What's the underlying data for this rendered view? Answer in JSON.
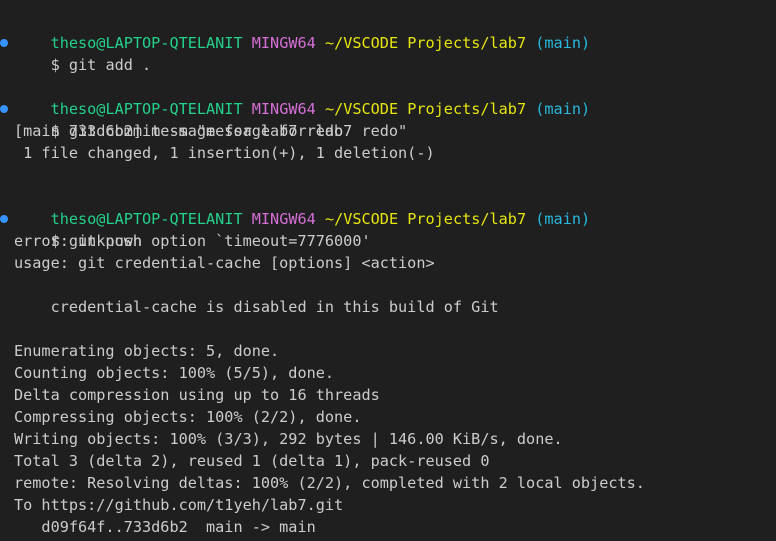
{
  "colors": {
    "background": "#1f1f1f",
    "text": "#cccccc",
    "user": "#23d18b",
    "host": "#d670d6",
    "path": "#e5e510",
    "branch": "#29b8db",
    "marker": "#3794ff"
  },
  "prompt": {
    "user": "theso@LAPTOP-QTELANIT",
    "host": "MINGW64",
    "path": "~/VSCODE Projects/lab7",
    "branch": "(main)"
  },
  "blocks": [
    {
      "command": "$ git add .",
      "output": []
    },
    {
      "command": "$ git commit -m \"message for lab7 redo\"",
      "output": [
        "[main 733d6b2] message for lab7 redo",
        " 1 file changed, 1 insertion(+), 1 deletion(-)"
      ]
    },
    {
      "command": "$ git push",
      "output": [
        "error: unknown option `timeout=7776000'",
        "usage: git credential-cache [options] <action>",
        "",
        "    credential-cache is disabled in this build of Git",
        "",
        "Enumerating objects: 5, done.",
        "Counting objects: 100% (5/5), done.",
        "Delta compression using up to 16 threads",
        "Compressing objects: 100% (2/2), done.",
        "Writing objects: 100% (3/3), 292 bytes | 146.00 KiB/s, done.",
        "Total 3 (delta 2), reused 1 (delta 1), pack-reused 0",
        "remote: Resolving deltas: 100% (2/2), completed with 2 local objects.",
        "To https://github.com/t1yeh/lab7.git",
        "   d09f64f..733d6b2  main -> main"
      ]
    }
  ]
}
